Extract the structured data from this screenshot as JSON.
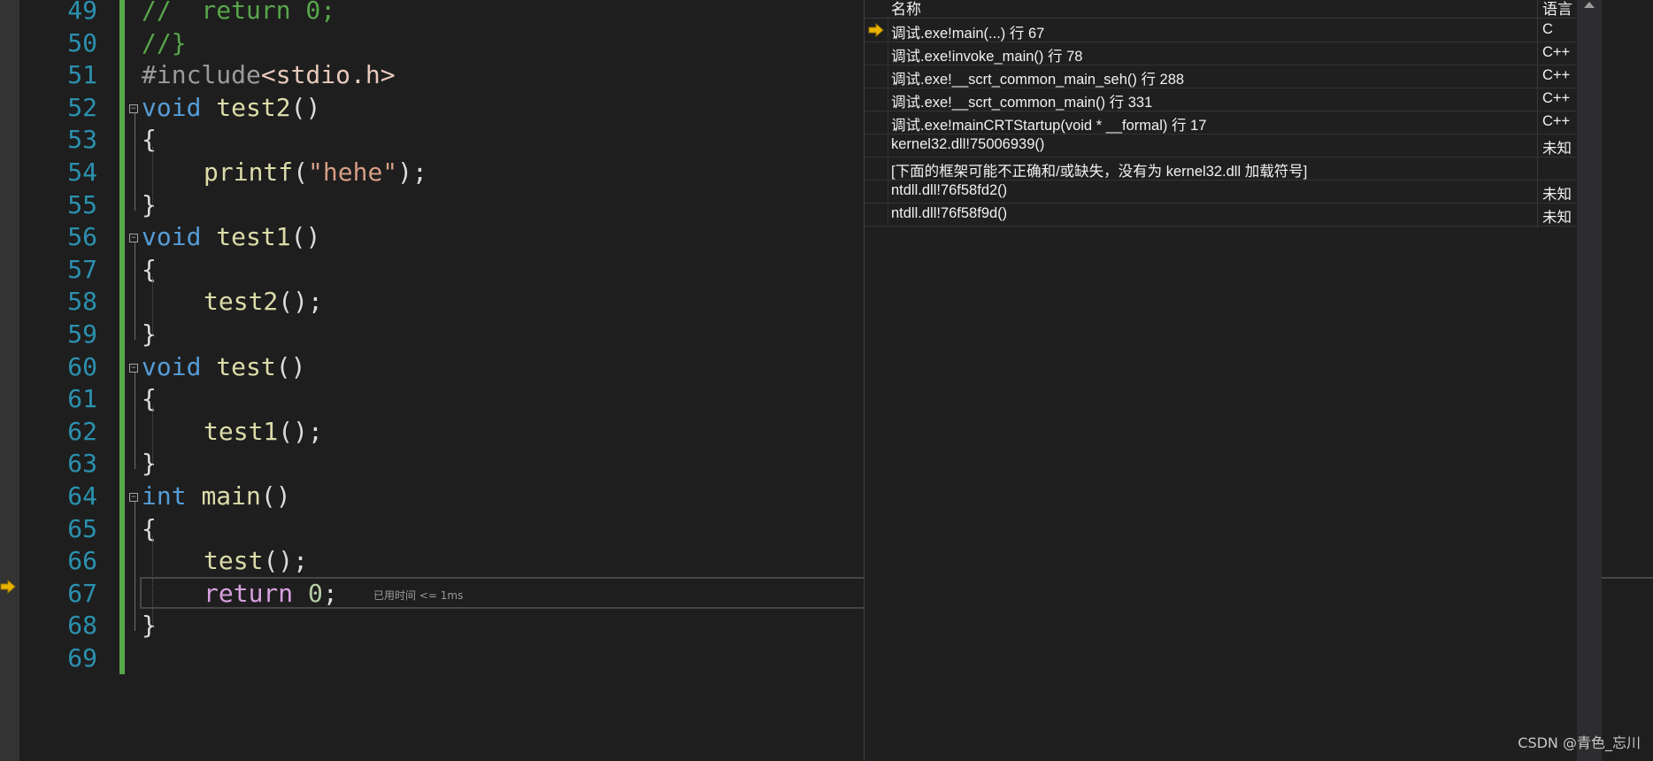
{
  "editor": {
    "lines": [
      {
        "n": "49",
        "tokens": [
          {
            "t": "//  return 0;",
            "c": "cm"
          }
        ]
      },
      {
        "n": "50",
        "tokens": [
          {
            "t": "//}",
            "c": "cm"
          }
        ]
      },
      {
        "n": "51",
        "tokens": [
          {
            "t": "#include",
            "c": "pp"
          },
          {
            "t": "<stdio.h>",
            "c": "inc"
          }
        ]
      },
      {
        "n": "52",
        "fold": true,
        "tokens": [
          {
            "t": "void",
            "c": "kw"
          },
          {
            "t": " "
          },
          {
            "t": "test2",
            "c": "fn"
          },
          {
            "t": "()"
          }
        ]
      },
      {
        "n": "53",
        "tokens": [
          {
            "t": "{"
          }
        ]
      },
      {
        "n": "54",
        "indent": true,
        "tokens": [
          {
            "t": "printf",
            "c": "fn"
          },
          {
            "t": "("
          },
          {
            "t": "\"hehe\"",
            "c": "str"
          },
          {
            "t": ");"
          }
        ]
      },
      {
        "n": "55",
        "tokens": [
          {
            "t": "}"
          }
        ]
      },
      {
        "n": "56",
        "fold": true,
        "tokens": [
          {
            "t": "void",
            "c": "kw"
          },
          {
            "t": " "
          },
          {
            "t": "test1",
            "c": "fn"
          },
          {
            "t": "()"
          }
        ]
      },
      {
        "n": "57",
        "tokens": [
          {
            "t": "{"
          }
        ]
      },
      {
        "n": "58",
        "indent": true,
        "tokens": [
          {
            "t": "test2",
            "c": "fn"
          },
          {
            "t": "();"
          }
        ]
      },
      {
        "n": "59",
        "tokens": [
          {
            "t": "}"
          }
        ]
      },
      {
        "n": "60",
        "fold": true,
        "tokens": [
          {
            "t": "void",
            "c": "kw"
          },
          {
            "t": " "
          },
          {
            "t": "test",
            "c": "fn"
          },
          {
            "t": "()"
          }
        ]
      },
      {
        "n": "61",
        "tokens": [
          {
            "t": "{"
          }
        ]
      },
      {
        "n": "62",
        "indent": true,
        "tokens": [
          {
            "t": "test1",
            "c": "fn"
          },
          {
            "t": "();"
          }
        ]
      },
      {
        "n": "63",
        "tokens": [
          {
            "t": "}"
          }
        ]
      },
      {
        "n": "64",
        "fold": true,
        "tokens": [
          {
            "t": "int",
            "c": "kw"
          },
          {
            "t": " "
          },
          {
            "t": "main",
            "c": "fn"
          },
          {
            "t": "()"
          }
        ]
      },
      {
        "n": "65",
        "tokens": [
          {
            "t": "{"
          }
        ]
      },
      {
        "n": "66",
        "indent": true,
        "tokens": [
          {
            "t": "test",
            "c": "fn"
          },
          {
            "t": "();"
          }
        ]
      },
      {
        "n": "67",
        "indent": true,
        "current": true,
        "tokens": [
          {
            "t": "return",
            "c": "ctl"
          },
          {
            "t": " "
          },
          {
            "t": "0",
            "c": "num"
          },
          {
            "t": ";"
          }
        ]
      },
      {
        "n": "68",
        "tokens": [
          {
            "t": "}"
          }
        ]
      },
      {
        "n": "69",
        "tokens": []
      }
    ],
    "perf_tip": "已用时间 <= 1ms"
  },
  "callstack": {
    "header_name": "名称",
    "header_lang": "语言",
    "rows": [
      {
        "name": "调试.exe!main(...) 行 67",
        "lang": "C",
        "current": true
      },
      {
        "name": "调试.exe!invoke_main() 行 78",
        "lang": "C++"
      },
      {
        "name": "调试.exe!__scrt_common_main_seh() 行 288",
        "lang": "C++"
      },
      {
        "name": "调试.exe!__scrt_common_main() 行 331",
        "lang": "C++"
      },
      {
        "name": "调试.exe!mainCRTStartup(void * __formal) 行 17",
        "lang": "C++"
      },
      {
        "name": "kernel32.dll!75006939()",
        "lang": "未知"
      },
      {
        "name": "[下面的框架可能不正确和/或缺失，没有为 kernel32.dll 加载符号]",
        "lang": ""
      },
      {
        "name": "ntdll.dll!76f58fd2()",
        "lang": "未知"
      },
      {
        "name": "ntdll.dll!76f58f9d()",
        "lang": "未知"
      }
    ]
  },
  "watermark": "CSDN @青色_忘川",
  "icons": {
    "execution_arrow": "arrow-right-icon",
    "fold_toggle": "minus-box-icon",
    "scroll_up": "chevron-up-icon"
  },
  "colors": {
    "background": "#1e1e1e",
    "keyword": "#569cd6",
    "function": "#dcdcaa",
    "string": "#d69d85",
    "comment": "#57a64a",
    "line_number": "#2b91af",
    "arrow": "#e8b400"
  }
}
